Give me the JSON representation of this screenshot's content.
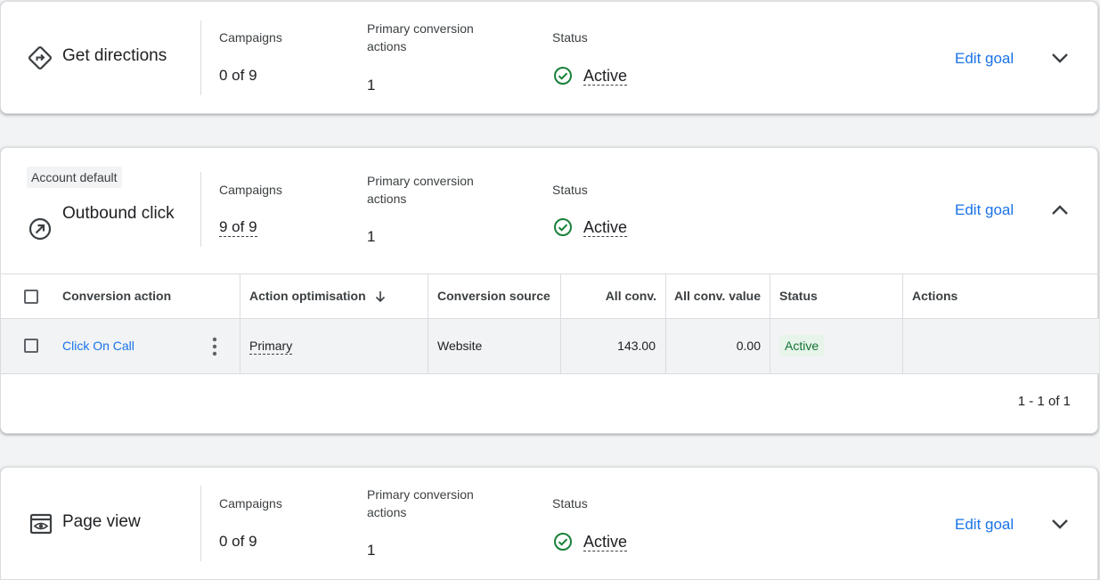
{
  "colors": {
    "accent": "#1a73e8",
    "success": "#188038",
    "pill_bg": "#e6f4ea"
  },
  "goals": [
    {
      "name": "Get directions",
      "icon": "directions-icon",
      "campaigns_label": "Campaigns",
      "campaigns_value": "0 of 9",
      "primary_label": "Primary conversion actions",
      "primary_value": "1",
      "status_label": "Status",
      "status_value": "Active",
      "edit_label": "Edit goal",
      "expanded": false
    },
    {
      "badge": "Account default",
      "name": "Outbound click",
      "icon": "outbound-icon",
      "campaigns_label": "Campaigns",
      "campaigns_value": "9 of 9",
      "primary_label": "Primary conversion actions",
      "primary_value": "1",
      "status_label": "Status",
      "status_value": "Active",
      "edit_label": "Edit goal",
      "expanded": true,
      "table": {
        "columns": [
          "Conversion action",
          "Action optimisation",
          "Conversion source",
          "All conv.",
          "All conv. value",
          "Status",
          "Actions"
        ],
        "rows": [
          {
            "action": "Click On Call",
            "optimisation": "Primary",
            "source": "Website",
            "all_conv": "143.00",
            "all_conv_value": "0.00",
            "status": "Active",
            "actions": ""
          }
        ],
        "pagination": "1 - 1 of 1"
      }
    },
    {
      "name": "Page view",
      "icon": "page-view-icon",
      "campaigns_label": "Campaigns",
      "campaigns_value": "0 of 9",
      "primary_label": "Primary conversion actions",
      "primary_value": "1",
      "status_label": "Status",
      "status_value": "Active",
      "edit_label": "Edit goal",
      "expanded": false
    }
  ]
}
